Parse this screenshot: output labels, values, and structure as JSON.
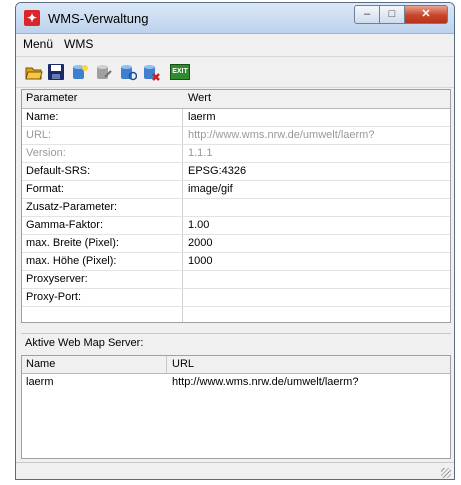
{
  "window": {
    "title": "WMS-Verwaltung",
    "min_glyph": "–",
    "max_glyph": "□",
    "close_glyph": "✕"
  },
  "menu": [
    "Menü",
    "WMS"
  ],
  "toolbar": {
    "buttons": [
      {
        "name": "open-folder-icon",
        "color": "#e3a21a"
      },
      {
        "name": "save-icon",
        "color": "#1a2a66"
      },
      {
        "name": "add-server-icon",
        "color": "#3f7fd0"
      },
      {
        "name": "edit-server-icon",
        "color": "#a0a0a0"
      },
      {
        "name": "refresh-server-icon",
        "color": "#3f7fd0"
      },
      {
        "name": "delete-server-icon",
        "color": "#cc1f1f"
      },
      {
        "name": "exit-icon",
        "color": "#2e8b2e",
        "label": "EXIT"
      }
    ]
  },
  "properties": {
    "headers": {
      "param": "Parameter",
      "value": "Wert"
    },
    "rows": [
      {
        "param": "Name:",
        "value": "laerm",
        "disabled": false
      },
      {
        "param": "URL:",
        "value": "http://www.wms.nrw.de/umwelt/laerm?",
        "disabled": true
      },
      {
        "param": "Version:",
        "value": "1.1.1",
        "disabled": true
      },
      {
        "param": "Default-SRS:",
        "value": "EPSG:4326",
        "disabled": false
      },
      {
        "param": "Format:",
        "value": "image/gif",
        "disabled": false
      },
      {
        "param": "Zusatz-Parameter:",
        "value": "",
        "disabled": false
      },
      {
        "param": "Gamma-Faktor:",
        "value": "1.00",
        "disabled": false
      },
      {
        "param": "max. Breite (Pixel):",
        "value": "2000",
        "disabled": false
      },
      {
        "param": "max. Höhe (Pixel):",
        "value": "1000",
        "disabled": false
      },
      {
        "param": "Proxyserver:",
        "value": "",
        "disabled": false
      },
      {
        "param": "Proxy-Port:",
        "value": "",
        "disabled": false
      }
    ]
  },
  "servers": {
    "label": "Aktive Web Map Server:",
    "headers": {
      "name": "Name",
      "url": "URL"
    },
    "rows": [
      {
        "name": "laerm",
        "url": "http://www.wms.nrw.de/umwelt/laerm?"
      }
    ]
  }
}
